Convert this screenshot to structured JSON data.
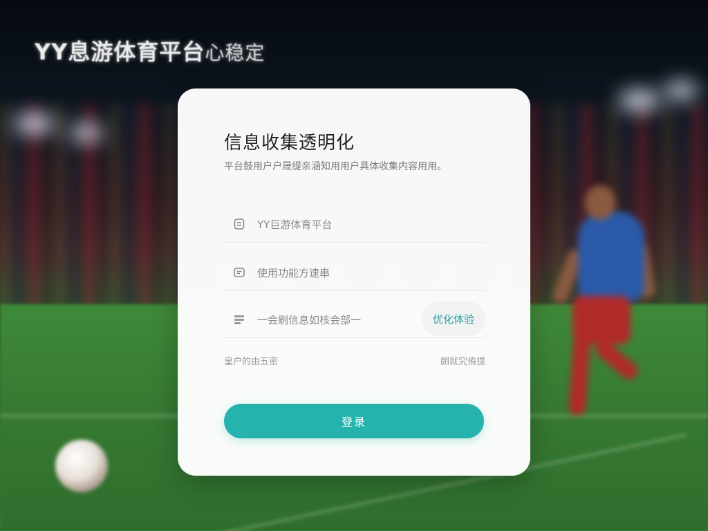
{
  "brand": {
    "name": "YY息游体育平台",
    "tagline": "心稳定"
  },
  "card": {
    "title": "信息收集透明化",
    "subtitle": "平台鼓用户户晟缇亲涵知用用户具体收集内容用用。"
  },
  "fields": [
    {
      "icon": "document-icon",
      "text": "YY巨游体育平台"
    },
    {
      "icon": "chat-icon",
      "text": "使用功能方速串"
    },
    {
      "icon": "list-icon",
      "text": "一会刷信息如核会部一",
      "action": "优化体验"
    }
  ],
  "links": {
    "left": "皇户的由五密",
    "right": "朗就究侑提"
  },
  "login_button": "登录",
  "colors": {
    "accent": "#26b3ad",
    "action_text": "#2a9da4",
    "card_bg": "#ffffff"
  }
}
